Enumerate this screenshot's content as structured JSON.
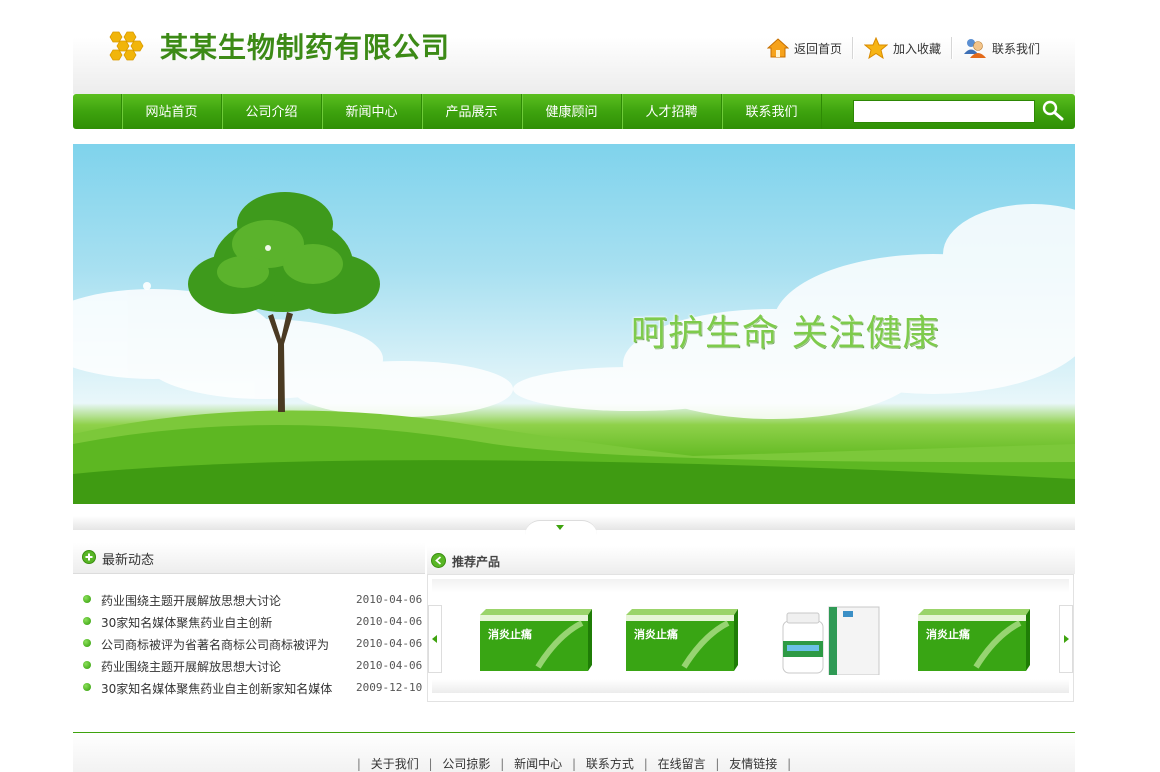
{
  "header": {
    "company_name": "某某生物制药有限公司",
    "quick_links": [
      {
        "label": "返回首页",
        "icon": "home-icon"
      },
      {
        "label": "加入收藏",
        "icon": "star-icon"
      },
      {
        "label": "联系我们",
        "icon": "contact-person-icon"
      }
    ]
  },
  "nav": {
    "items": [
      "网站首页",
      "公司介绍",
      "新闻中心",
      "产品展示",
      "健康顾问",
      "人才招聘",
      "联系我们"
    ],
    "search": {
      "value": "",
      "icon": "search-icon"
    }
  },
  "banner": {
    "slogan": "呵护生命 关注健康"
  },
  "news": {
    "title": "最新动态",
    "items": [
      {
        "title": "药业围绕主题开展解放思想大讨论",
        "date": "2010-04-06"
      },
      {
        "title": "30家知名媒体聚焦药业自主创新",
        "date": "2010-04-06"
      },
      {
        "title": "公司商标被评为省著名商标公司商标被评为",
        "date": "2010-04-06"
      },
      {
        "title": "药业围绕主题开展解放思想大讨论",
        "date": "2010-04-06"
      },
      {
        "title": "30家知名媒体聚焦药业自主创新家知名媒体",
        "date": "2009-12-10"
      }
    ]
  },
  "products": {
    "title": "推荐产品",
    "items": [
      {
        "name": "消炎止痛",
        "kind": "green-box"
      },
      {
        "name": "消炎止痛",
        "kind": "green-box"
      },
      {
        "name": "",
        "kind": "bottle-and-box"
      },
      {
        "name": "消炎止痛",
        "kind": "green-box"
      }
    ]
  },
  "footer": {
    "links": [
      "关于我们",
      "公司掠影",
      "新闻中心",
      "联系方式",
      "在线留言",
      "友情链接"
    ]
  },
  "colors": {
    "brand_green": "#3ea30e",
    "logo_text": "#3c8a16",
    "logo_hex": "#f1b50a"
  }
}
